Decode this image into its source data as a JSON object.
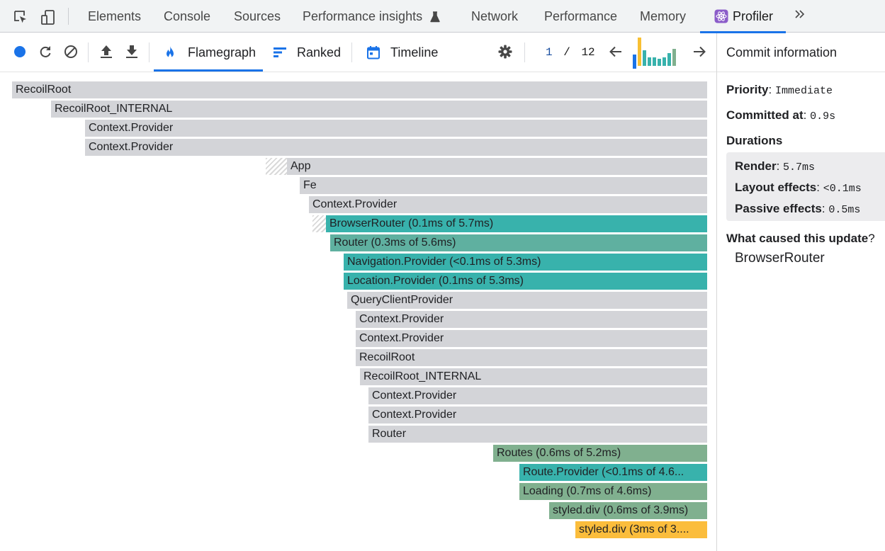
{
  "devtools": {
    "tabs": [
      {
        "label": "Elements"
      },
      {
        "label": "Console"
      },
      {
        "label": "Sources"
      },
      {
        "label": "Performance insights"
      },
      {
        "label": "Network"
      },
      {
        "label": "Performance"
      },
      {
        "label": "Memory"
      },
      {
        "label": "Profiler"
      }
    ],
    "active_tab": "Profiler",
    "icons": [
      "inspect-element-icon",
      "device-toolbar-icon",
      "flask-icon",
      "react-icon",
      "more-tabs-chevron-icon"
    ]
  },
  "profiler": {
    "toolbar": {
      "icons": [
        "record-icon",
        "reload-and-profile-icon",
        "clear-icon",
        "upload-icon",
        "download-icon",
        "settings-icon",
        "prev-commit-icon",
        "next-commit-icon"
      ],
      "tabs": [
        {
          "label": "Flamegraph",
          "icon": "flame-icon"
        },
        {
          "label": "Ranked",
          "icon": "ranked-icon"
        },
        {
          "label": "Timeline",
          "icon": "calendar-icon"
        }
      ],
      "active_tab": "Flamegraph",
      "commit_index": "1",
      "commit_separator": "/",
      "commit_total": "12",
      "commit_chart_levels": [
        0.4,
        1.0,
        0.55,
        0.3,
        0.3,
        0.25,
        0.3,
        0.45,
        0.6
      ],
      "commit_chart_colors": [
        "#1a73e8",
        "#f8c033",
        "#38b2ac",
        "#38b2ac",
        "#38b2ac",
        "#38b2ac",
        "#38b2ac",
        "#38b2ac",
        "#80b08f"
      ]
    },
    "colors": {
      "accent": "#1a73e8",
      "gray": "#d3d4d8",
      "teal": "#38b2ac",
      "green": "#80b08f",
      "yellow": "#fbbd3c"
    },
    "flamegraph": {
      "nodes": [
        {
          "label": "RecoilRoot"
        },
        {
          "label": "RecoilRoot_INTERNAL"
        },
        {
          "label": "Context.Provider"
        },
        {
          "label": "Context.Provider"
        },
        {
          "label": "App"
        },
        {
          "label": "Fe"
        },
        {
          "label": "Context.Provider"
        },
        {
          "label": "BrowserRouter (0.1ms of 5.7ms)"
        },
        {
          "label": "Router (0.3ms of 5.6ms)"
        },
        {
          "label": "Navigation.Provider (<0.1ms of 5.3ms)"
        },
        {
          "label": "Location.Provider (0.1ms of 5.3ms)"
        },
        {
          "label": "QueryClientProvider"
        },
        {
          "label": "Context.Provider"
        },
        {
          "label": "Context.Provider"
        },
        {
          "label": "RecoilRoot"
        },
        {
          "label": "RecoilRoot_INTERNAL"
        },
        {
          "label": "Context.Provider"
        },
        {
          "label": "Context.Provider"
        },
        {
          "label": "Router"
        },
        {
          "label": "Routes (0.6ms of 5.2ms)"
        },
        {
          "label": "Route.Provider (<0.1ms of 4.6..."
        },
        {
          "label": "Loading (0.7ms of 4.6ms)"
        },
        {
          "label": "styled.div (0.6ms of 3.9ms)"
        },
        {
          "label": "styled.div (3ms of 3...."
        }
      ]
    },
    "commit_info": {
      "title": "Commit information",
      "priority_label": "Priority",
      "priority_value": "Immediate",
      "committed_at_label": "Committed at",
      "committed_at_value": "0.9s",
      "durations_label": "Durations",
      "render_label": "Render",
      "render_value": "5.7ms",
      "layout_effects_label": "Layout effects",
      "layout_effects_value": "<0.1ms",
      "passive_effects_label": "Passive effects",
      "passive_effects_value": "0.5ms",
      "cause_label": "What caused this update",
      "cause_suffix": "?",
      "cause_value": "BrowserRouter"
    }
  }
}
